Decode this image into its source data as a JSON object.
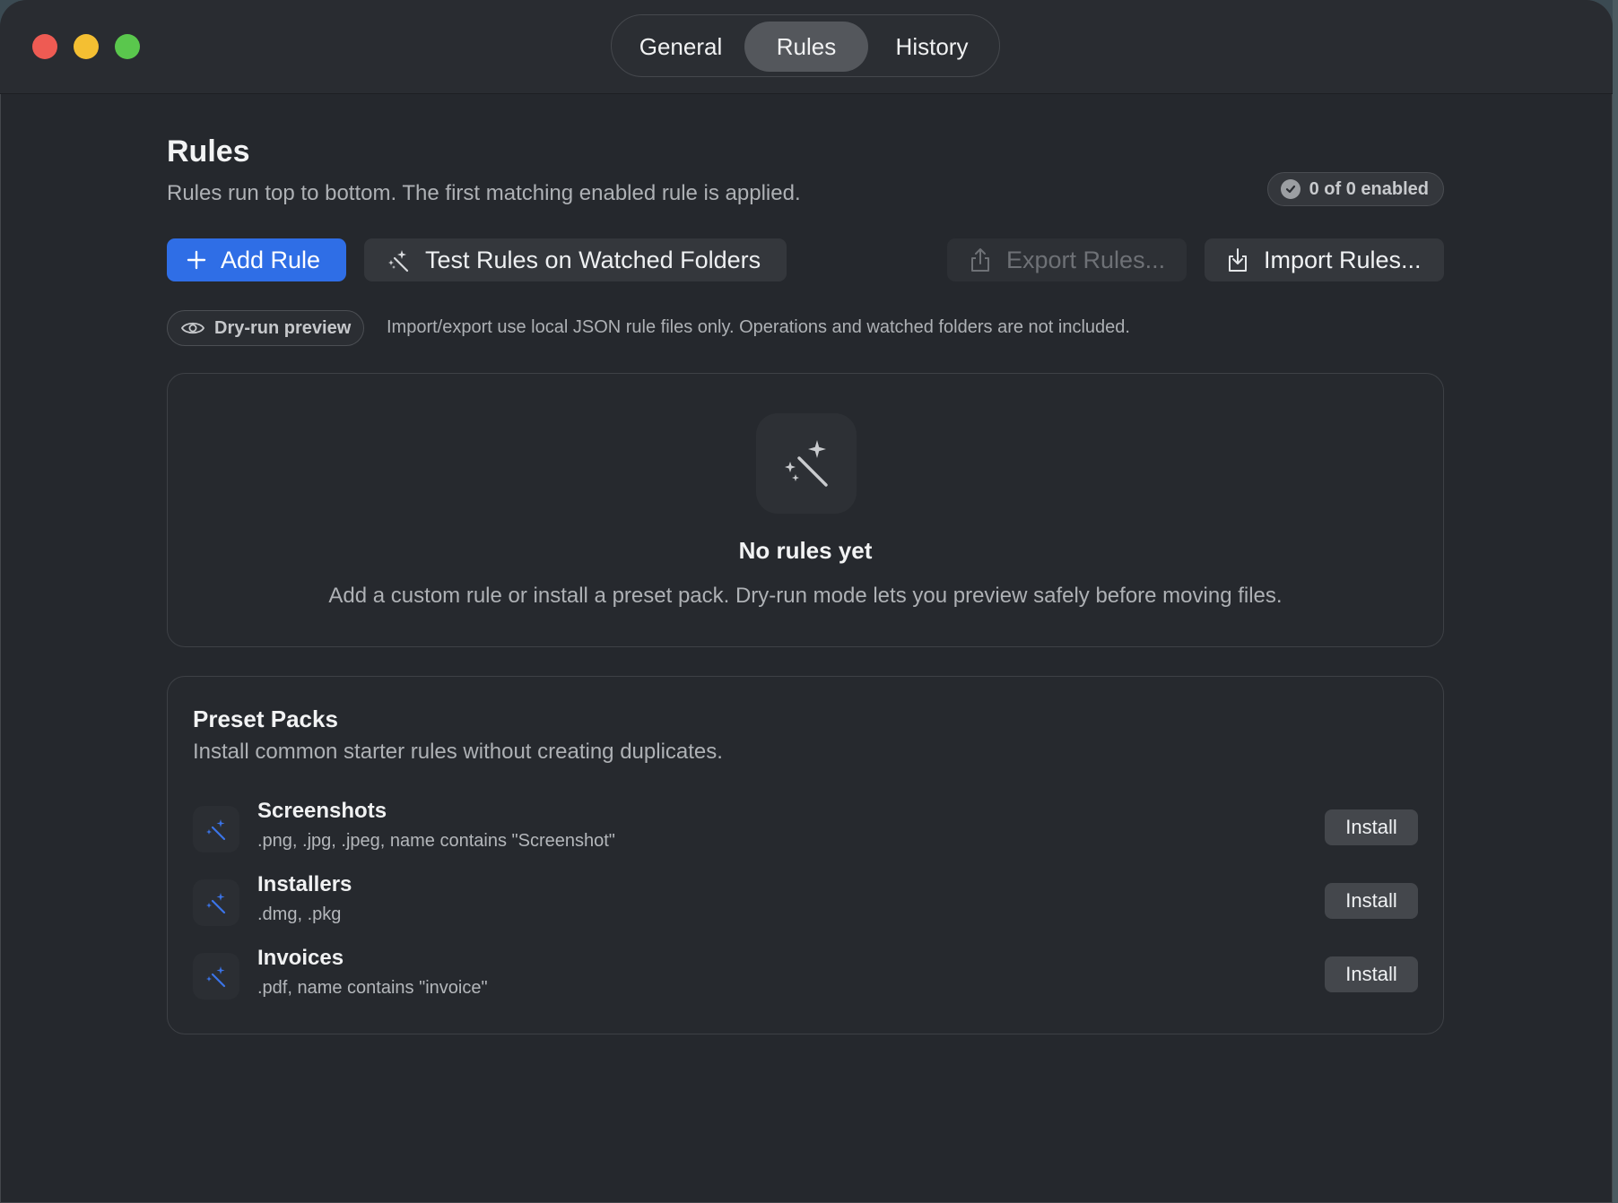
{
  "tabs": [
    {
      "label": "General"
    },
    {
      "label": "Rules"
    },
    {
      "label": "History"
    }
  ],
  "active_tab": "Rules",
  "header": {
    "title": "Rules",
    "subtitle": "Rules run top to bottom. The first matching enabled rule is applied.",
    "enabled_badge": "0 of 0 enabled"
  },
  "toolbar": {
    "add_rule": "Add Rule",
    "test_rules": "Test Rules on Watched Folders",
    "export_rules": "Export Rules...",
    "import_rules": "Import Rules..."
  },
  "dry_run": {
    "label": "Dry-run preview",
    "note": "Import/export use local JSON rule files only. Operations and watched folders are not included."
  },
  "empty_state": {
    "title": "No rules yet",
    "subtitle": "Add a custom rule or install a preset pack. Dry-run mode lets you preview safely before moving files.",
    "icon": "magic-wand-icon"
  },
  "preset_packs": {
    "title": "Preset Packs",
    "subtitle": "Install common starter rules without creating duplicates.",
    "items": [
      {
        "name": "Screenshots",
        "description": ".png, .jpg, .jpeg, name contains \"Screenshot\"",
        "action": "Install",
        "icon": "magic-wand-icon"
      },
      {
        "name": "Installers",
        "description": ".dmg, .pkg",
        "action": "Install",
        "icon": "magic-wand-icon"
      },
      {
        "name": "Invoices",
        "description": ".pdf, name contains \"invoice\"",
        "action": "Install",
        "icon": "magic-wand-icon"
      }
    ]
  },
  "colors": {
    "accent": "#2f6ee6",
    "window_bg": "#25282d",
    "wand_icon": "#3b74e8"
  }
}
